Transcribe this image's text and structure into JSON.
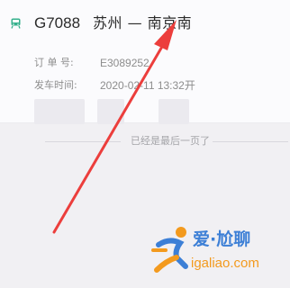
{
  "order": {
    "train_number": "G7088",
    "route": "苏州 — 南京南",
    "order_no_label": "订 单 号:",
    "order_no_value": "E3089252",
    "departure_label": "发车时间:",
    "departure_value": "2020-02-11  13:32开"
  },
  "list_end_text": "已经是最后一页了",
  "watermark": {
    "brand_text": "爱·尬聊",
    "url": "igaliao.com"
  },
  "colors": {
    "accent_train_icon": "#35b08c",
    "arrow": "#ec3e3c",
    "watermark_blue": "#3c7fd6",
    "watermark_orange": "#f39a1e"
  },
  "icons": {
    "train": "train-icon",
    "logo": "runner-logo-icon"
  }
}
